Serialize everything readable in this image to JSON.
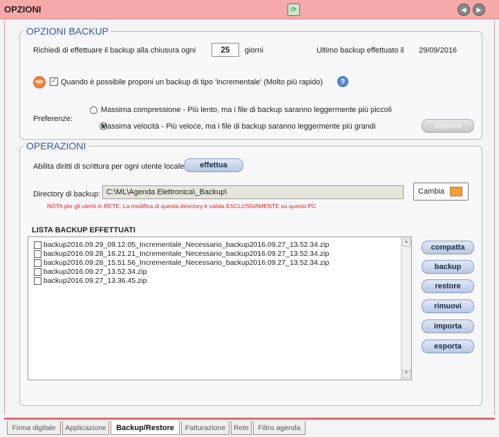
{
  "window": {
    "title": "OPZIONI"
  },
  "backup": {
    "legend": "OPZIONI BACKUP",
    "ask_label": "Richiedi di effettuare il backup alla chiusura ogni",
    "days_value": "25",
    "days_unit": "giorni",
    "last_label": "Ultimo backup effettuato il",
    "last_date": "29/09/2016",
    "new_badge": "NEW",
    "incremental_label": "Quando è possibile proponi un backup di tipo 'incrementale' (Molto più rapido)",
    "incremental_checked": true,
    "prefs_label": "Preferenze:",
    "option_compress": "Massima compressione - Più lento, ma i file di backup saranno leggermente più piccoli",
    "option_speed": "Massima velocità - Più veloce, ma i file di backup saranno leggermente più grandi",
    "selected_option": "speed",
    "apply_label": "applica"
  },
  "operations": {
    "legend": "OPERAZIONI",
    "rights_label": "Abilita diritti di scrittura per ogni utente locale",
    "effettua_label": "effettua",
    "dir_label": "Directory di backup:",
    "dir_value": "C:\\ML\\Agenda Elettronica\\_Backup\\",
    "change_label": "Cambia",
    "note": "NOTA per gli utenti in RETE: La modifica di questa directory è valida ESCLUSIVAMENTE su questo PC",
    "list_title": "LISTA BACKUP EFFETTUATI",
    "files": [
      "backup2016.09.29_09.12.05_Incrementale_Necessario_backup2016.09.27_13.52.34.zip",
      "backup2016.09.28_16.21.21_Incrementale_Necessario_backup2016.09.27_13.52.34.zip",
      "backup2016.09.28_15.51.56_Incrementale_Necessario_backup2016.09.27_13.52.34.zip",
      "backup2016.09.27_13.52.34.zip",
      "backup2016.09.27_13.36.45.zip"
    ],
    "buttons": {
      "compatta": "compatta",
      "backup": "backup",
      "restore": "restore",
      "rimuovi": "rimuovi",
      "importa": "importa",
      "esporta": "esporta"
    }
  },
  "tabs": [
    "Firma digitale",
    "Applicazione",
    "Backup/Restore",
    "Fatturazione",
    "Rete",
    "Filtro agenda"
  ],
  "active_tab": "Backup/Restore",
  "colors": {
    "titlebar": "#f7a8a8",
    "accent": "#e26a6a",
    "legend": "#3a5a9a"
  }
}
